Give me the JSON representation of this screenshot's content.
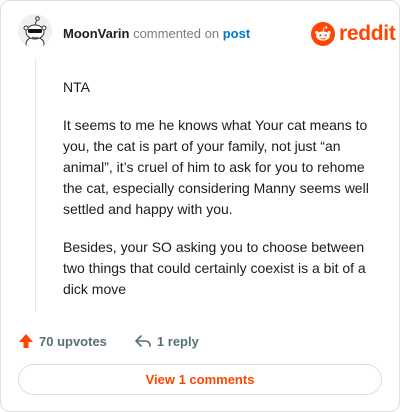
{
  "comment": {
    "username": "MoonVarin",
    "action_text": "commented on",
    "post_link": "post",
    "paragraphs": [
      "NTA",
      "It seems to me he knows what Your cat means to you, the cat is part of your family, not just “an animal”, it’s cruel of him to ask for you to rehome the cat, especially considering Manny seems well settled and happy with you.",
      "Besides, your SO asking you to choose between two things that could certainly coexist is a bit of a dick move"
    ]
  },
  "brand": {
    "wordmark": "reddit",
    "color": "#ff4500"
  },
  "actions": {
    "upvotes_label": "70 upvotes",
    "reply_label": "1 reply",
    "upvote_color": "#ff4500"
  },
  "footer": {
    "view_button_label": "View 1 comments"
  }
}
